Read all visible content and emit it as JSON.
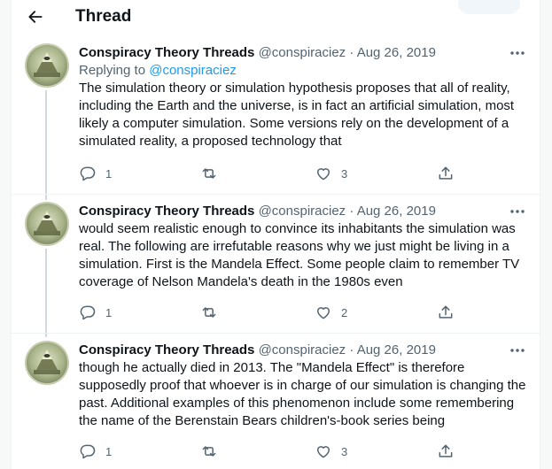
{
  "header": {
    "title": "Thread"
  },
  "tweets": [
    {
      "name": "Conspiracy Theory Threads",
      "handle": "@conspiraciez",
      "sep": "·",
      "date": "Aug 26, 2019",
      "replying_prefix": "Replying to",
      "replying_handle": "@conspiraciez",
      "lines": [
        "The simulation theory or simulation hypothesis proposes that all of reality,",
        "including the Earth and the universe, is in fact an artificial simulation, most",
        "likely a computer simulation. Some versions rely on the development of a",
        "simulated reality, a proposed technology that"
      ],
      "replies": "1",
      "retweets": "",
      "likes": "3"
    },
    {
      "name": "Conspiracy Theory Threads",
      "handle": "@conspiraciez",
      "sep": "·",
      "date": "Aug 26, 2019",
      "lines": [
        "would seem realistic enough to convince its inhabitants the simulation was",
        "real. The following are irrefutable  reasons why we just might be living in a",
        "simulation. First is the Mandela Effect. Some people claim to remember TV",
        "coverage of Nelson Mandela's death in the 1980s even"
      ],
      "replies": "1",
      "retweets": "",
      "likes": "2"
    },
    {
      "name": "Conspiracy Theory Threads",
      "handle": "@conspiraciez",
      "sep": "·",
      "date": "Aug 26, 2019",
      "lines": [
        "though he actually died in 2013. The \"Mandela Effect\" is therefore",
        "supposedly proof that whoever is in charge of our simulation is changing the",
        "past. Additional examples of this phenomenon include some remembering",
        "the name of the Berenstain Bears children's-book series being"
      ],
      "replies": "1",
      "retweets": "",
      "likes": "3"
    }
  ],
  "colors": {
    "text": "#0f1419",
    "secondary": "#536471",
    "link": "#1d9bf0",
    "thread_line": "#cfd9de",
    "border": "#eff3f4"
  },
  "icons": {
    "back": "arrow-left-icon",
    "more": "more-horizontal-icon",
    "reply": "reply-bubble-icon",
    "retweet": "retweet-arrows-icon",
    "like": "heart-icon",
    "share": "share-upload-icon",
    "avatar": "pyramid-eye-avatar"
  }
}
